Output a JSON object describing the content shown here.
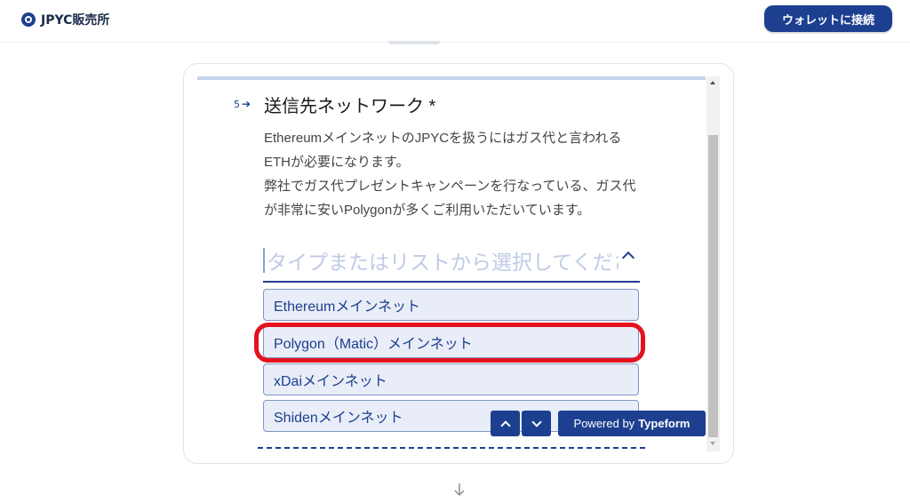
{
  "header": {
    "logo_text": "JPYC販売所",
    "connect_button": "ウォレットに接続"
  },
  "question": {
    "number": "5",
    "title": "送信先ネットワーク *",
    "description": [
      "EthereumメインネットのJPYCを扱うにはガス代と言われる",
      "ETHが必要になります。",
      "弊社でガス代プレゼントキャンペーンを行なっている、ガス代",
      "が非常に安いPolygonが多くご利用いただいています。"
    ],
    "input_placeholder": "タイプまたはリストから選択してください"
  },
  "options": [
    "Ethereumメインネット",
    "Polygon（Matic）メインネット",
    "xDaiメインネット",
    "Shidenメインネット"
  ],
  "footer": {
    "powered_by": "Powered by",
    "brand": "Typeform"
  },
  "colors": {
    "accent": "#1d3f8f",
    "highlight": "#e4121f",
    "option_bg": "#e8edf7"
  }
}
